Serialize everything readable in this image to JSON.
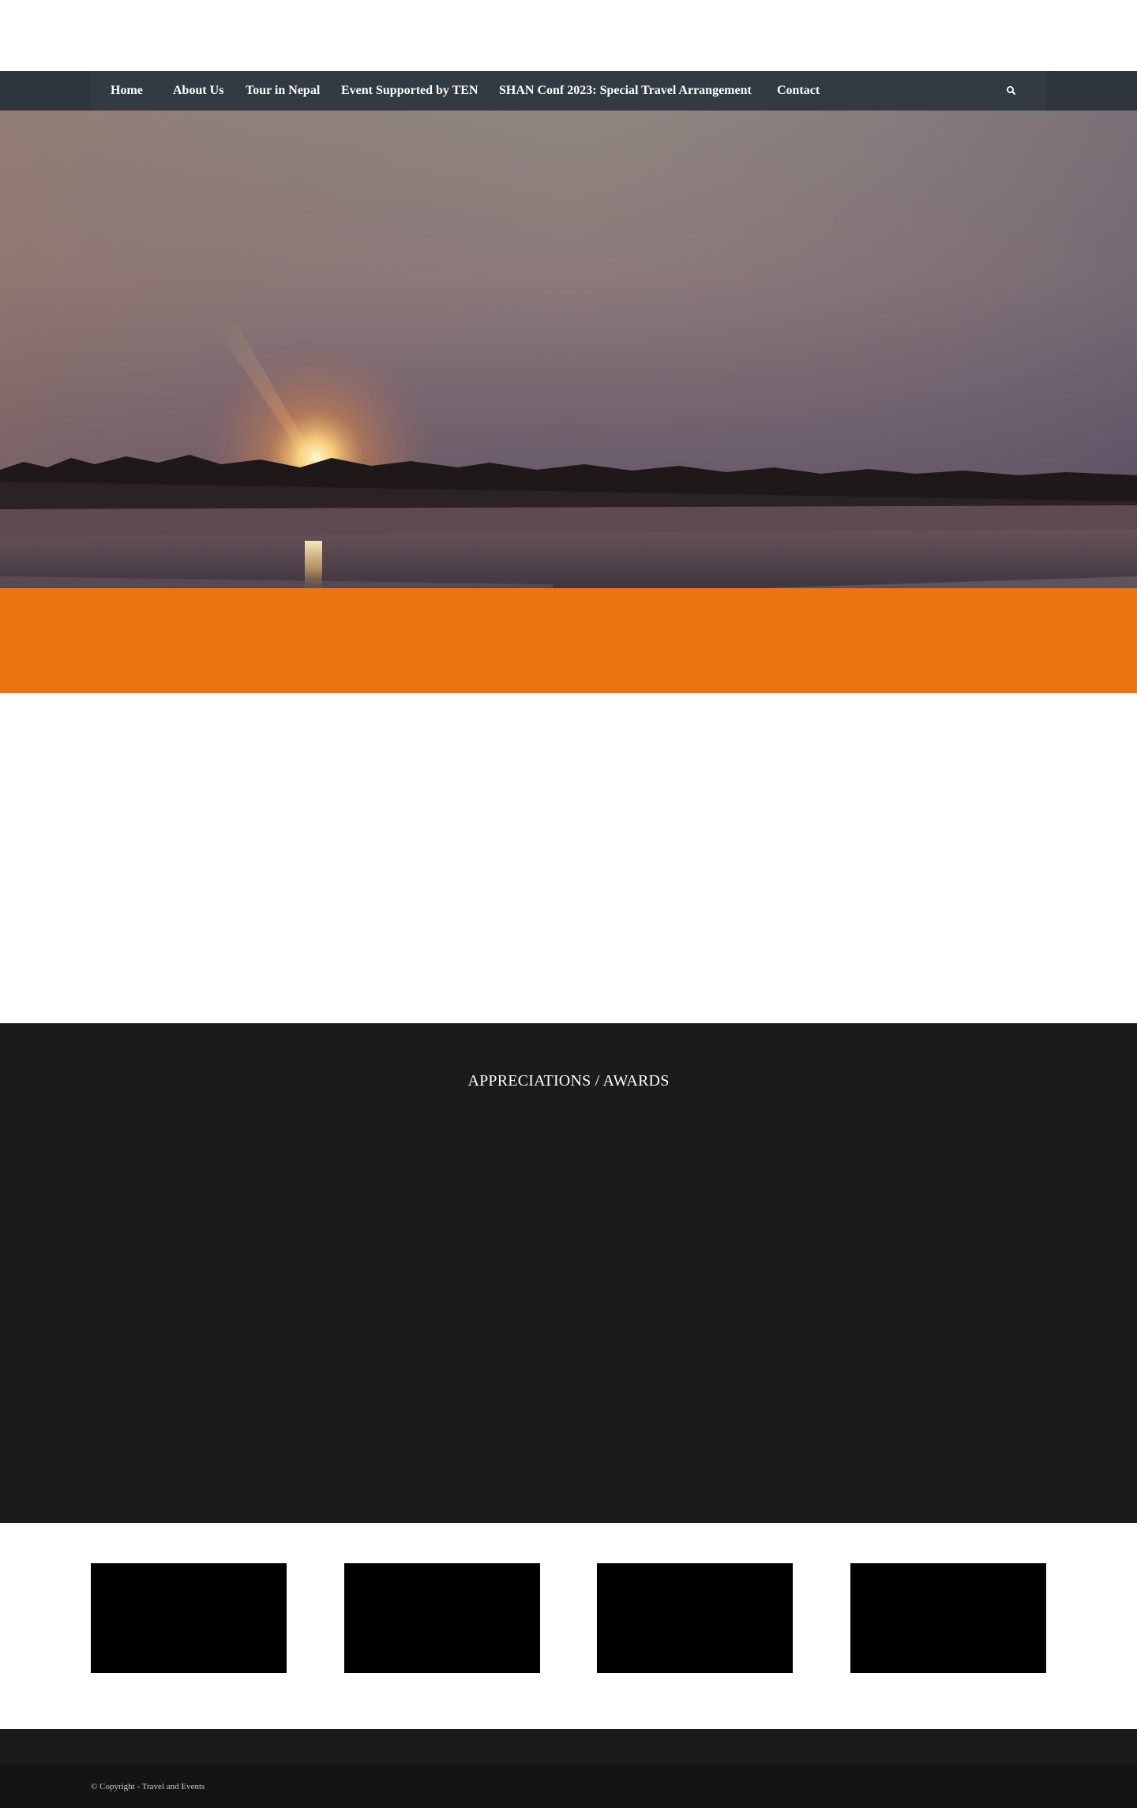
{
  "nav": {
    "items": [
      {
        "label": "Home"
      },
      {
        "label": "About Us"
      },
      {
        "label": "Tour in Nepal"
      },
      {
        "label": "Event Supported by TEN"
      },
      {
        "label": "SHAN Conf 2023: Special Travel Arrangement"
      },
      {
        "label": "Contact"
      }
    ],
    "search_icon": "search-icon"
  },
  "hero": {
    "image": "sunset over river"
  },
  "awards": {
    "title": "APPRECIATIONS / AWARDS"
  },
  "footer": {
    "copyright": "© Copyright - Travel and Events"
  },
  "colors": {
    "nav_bg": "#2e353d",
    "accent_orange": "#ed7412",
    "dark_section": "#1b1b1b",
    "footer_bg": "#141414"
  }
}
